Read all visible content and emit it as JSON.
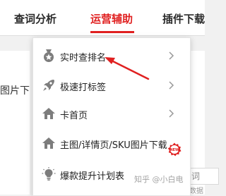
{
  "topnav": {
    "items": [
      {
        "label": "查词分析"
      },
      {
        "label": "运营辅助"
      },
      {
        "label": "插件下载"
      }
    ]
  },
  "background": {
    "left_text": "图片下",
    "right_box_text": "品词",
    "right_note": "数据"
  },
  "dropdown": {
    "items": [
      {
        "label": "实时查排名",
        "icon": "medal-icon"
      },
      {
        "label": "极速打标签",
        "icon": "rocket-icon"
      },
      {
        "label": "卡首页",
        "icon": "home-icon"
      },
      {
        "label": "主图/详情页/SKU图片下载",
        "icon": "home-icon",
        "badge": "NEW"
      },
      {
        "label": "爆款提升计划表",
        "icon": "lightbulb-icon"
      }
    ]
  },
  "watermark": "知乎 @小白电",
  "colors": {
    "accent": "#e02020",
    "icon_gray": "#7d7d7d"
  }
}
